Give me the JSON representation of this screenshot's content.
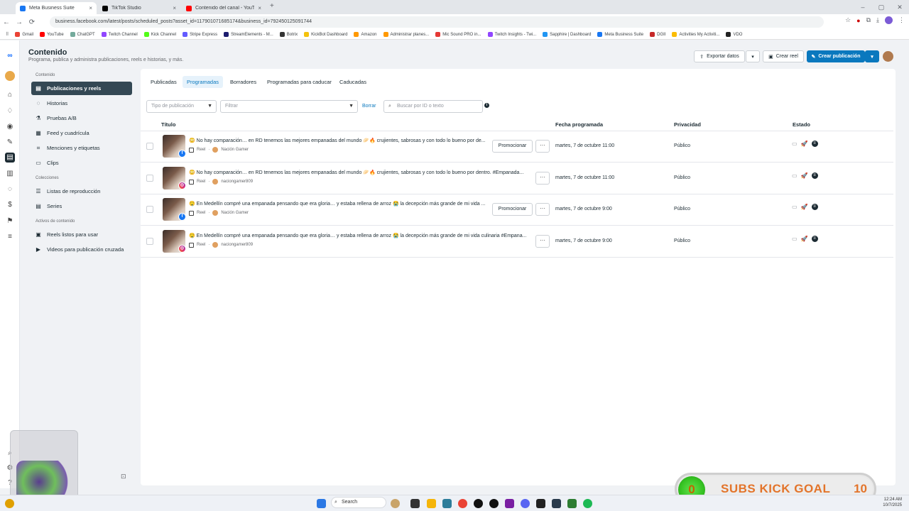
{
  "browser": {
    "tabs": [
      {
        "title": "Meta Business Suite",
        "color": "#1877f2"
      },
      {
        "title": "TikTok Studio",
        "color": "#000000"
      },
      {
        "title": "Contenido del canal - YouTube",
        "color": "#ff0000"
      }
    ],
    "url": "business.facebook.com/latest/posts/scheduled_posts?asset_id=117901071685174&business_id=792450125091744",
    "bookmarks": [
      "Gmail",
      "YouTube",
      "ChatGPT",
      "Twitch Channel",
      "Kick Channel",
      "Stripe Express",
      "StreamElements - M...",
      "Botrix",
      "KickBot Dashboard",
      "Amazon",
      "Administrar planes...",
      "Mic Sound PRO in...",
      "Twitch Insights - Twi...",
      "Sapphire | Dashboard",
      "Meta Business Suite",
      "DGII",
      "Activities My Activiti...",
      "VDO"
    ]
  },
  "header": {
    "title": "Contenido",
    "subtitle": "Programa, publica y administra publicaciones, reels e historias, y más.",
    "export_label": "Exportar datos",
    "create_reel_label": "Crear reel",
    "create_post_label": "Crear publicación"
  },
  "sidebar": {
    "section_content": "Contenido",
    "items_content": [
      "Publicaciones y reels",
      "Historias",
      "Pruebas A/B",
      "Feed y cuadrícula",
      "Menciones y etiquetas",
      "Clips"
    ],
    "section_collections": "Colecciones",
    "items_collections": [
      "Listas de reproducción",
      "Series"
    ],
    "section_assets": "Activos de contenido",
    "items_assets": [
      "Reels listos para usar",
      "Videos para publicación cruzada"
    ]
  },
  "tabs": [
    "Publicadas",
    "Programadas",
    "Borradores",
    "Programadas para caducar",
    "Caducadas"
  ],
  "filters": {
    "type_placeholder": "Tipo de publicación",
    "filter_placeholder": "Filtrar",
    "clear_label": "Borrar",
    "search_placeholder": "Buscar por ID o texto"
  },
  "columns": {
    "title": "Título",
    "date": "Fecha programada",
    "privacy": "Privacidad",
    "state": "Estado"
  },
  "rows": [
    {
      "platform": "fb",
      "title": "😳 No hay comparación… en RD tenemos las mejores empanadas del mundo 🥟🔥 crujientes, sabrosas y con todo lo bueno por de...",
      "type": "Reel",
      "account": "Nación Gamer",
      "promote": "Promocionar",
      "date": "martes, 7 de octubre 11:00",
      "privacy": "Público"
    },
    {
      "platform": "ig",
      "title": "😳 No hay comparación… en RD tenemos las mejores empanadas del mundo 🥟🔥 crujientes, sabrosas y con todo lo bueno por dentro. #Empanada...",
      "type": "Reel",
      "account": "naciongamer809",
      "promote": "",
      "date": "martes, 7 de octubre 11:00",
      "privacy": "Público"
    },
    {
      "platform": "fb",
      "title": "🤤 En Medellín compré una empanada pensando que era gloria… y estaba rellena de arroz 😭 la decepción más grande de mi vida ...",
      "type": "Reel",
      "account": "Nación Gamer",
      "promote": "Promocionar",
      "date": "martes, 7 de octubre 9:00",
      "privacy": "Público"
    },
    {
      "platform": "ig",
      "title": "🤤 En Medellín compré una empanada pensando que era gloria… y estaba rellena de arroz 😭 la decepción más grande de mi vida culinaria #Empana...",
      "type": "Reel",
      "account": "naciongamer809",
      "promote": "",
      "date": "martes, 7 de octubre 9:00",
      "privacy": "Público"
    }
  ],
  "overlay": {
    "goal_current": "0",
    "goal_label": "SUBS KICK GOAL",
    "goal_target": "10"
  },
  "taskbar": {
    "search_label": "Search",
    "time": "12:24 AM",
    "date": "10/7/2025"
  }
}
